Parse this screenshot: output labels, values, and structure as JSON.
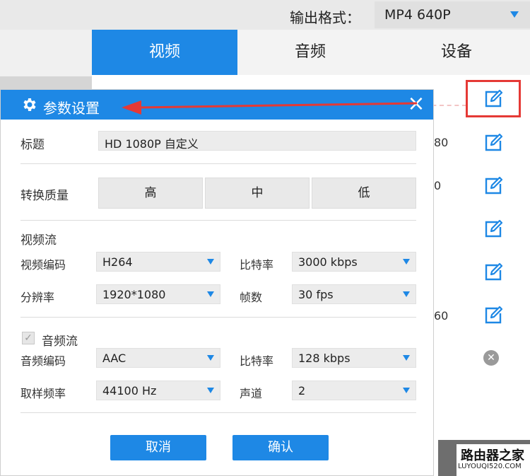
{
  "top_bar": {
    "format_label": "输出格式：",
    "format_value": "MP4  640P"
  },
  "background_panel": {
    "tabs": [
      {
        "label": "视频"
      },
      {
        "label": "音频"
      },
      {
        "label": "设备"
      }
    ],
    "fragments": [
      "80",
      "0",
      "60"
    ]
  },
  "dialog": {
    "title": "参数设置",
    "title_field": {
      "label": "标题",
      "value": "HD 1080P 自定义"
    },
    "quality": {
      "label": "转换质量",
      "options": [
        "高",
        "中",
        "低"
      ]
    },
    "video_stream": {
      "section_label": "视频流",
      "codec": {
        "label": "视频编码",
        "value": "H264"
      },
      "bitrate": {
        "label": "比特率",
        "value": "3000 kbps"
      },
      "resolution": {
        "label": "分辨率",
        "value": "1920*1080"
      },
      "fps": {
        "label": "帧数",
        "value": "30 fps"
      }
    },
    "audio_stream": {
      "section_label": "音频流",
      "enabled": true,
      "codec": {
        "label": "音频编码",
        "value": "AAC"
      },
      "bitrate": {
        "label": "比特率",
        "value": "128 kbps"
      },
      "sample_rate": {
        "label": "取样频率",
        "value": "44100 Hz"
      },
      "channels": {
        "label": "声道",
        "value": "2"
      }
    },
    "buttons": {
      "cancel": "取消",
      "confirm": "确认"
    }
  },
  "watermark": {
    "name": "路由器之家",
    "url": "LUYOUQI520.COM"
  },
  "colors": {
    "accent": "#1e88e5",
    "highlight": "#e53935"
  },
  "icons": [
    "chevron-down-icon",
    "gear-icon",
    "close-icon",
    "edit-icon",
    "remove-icon",
    "arrow-left-icon",
    "check-icon"
  ]
}
